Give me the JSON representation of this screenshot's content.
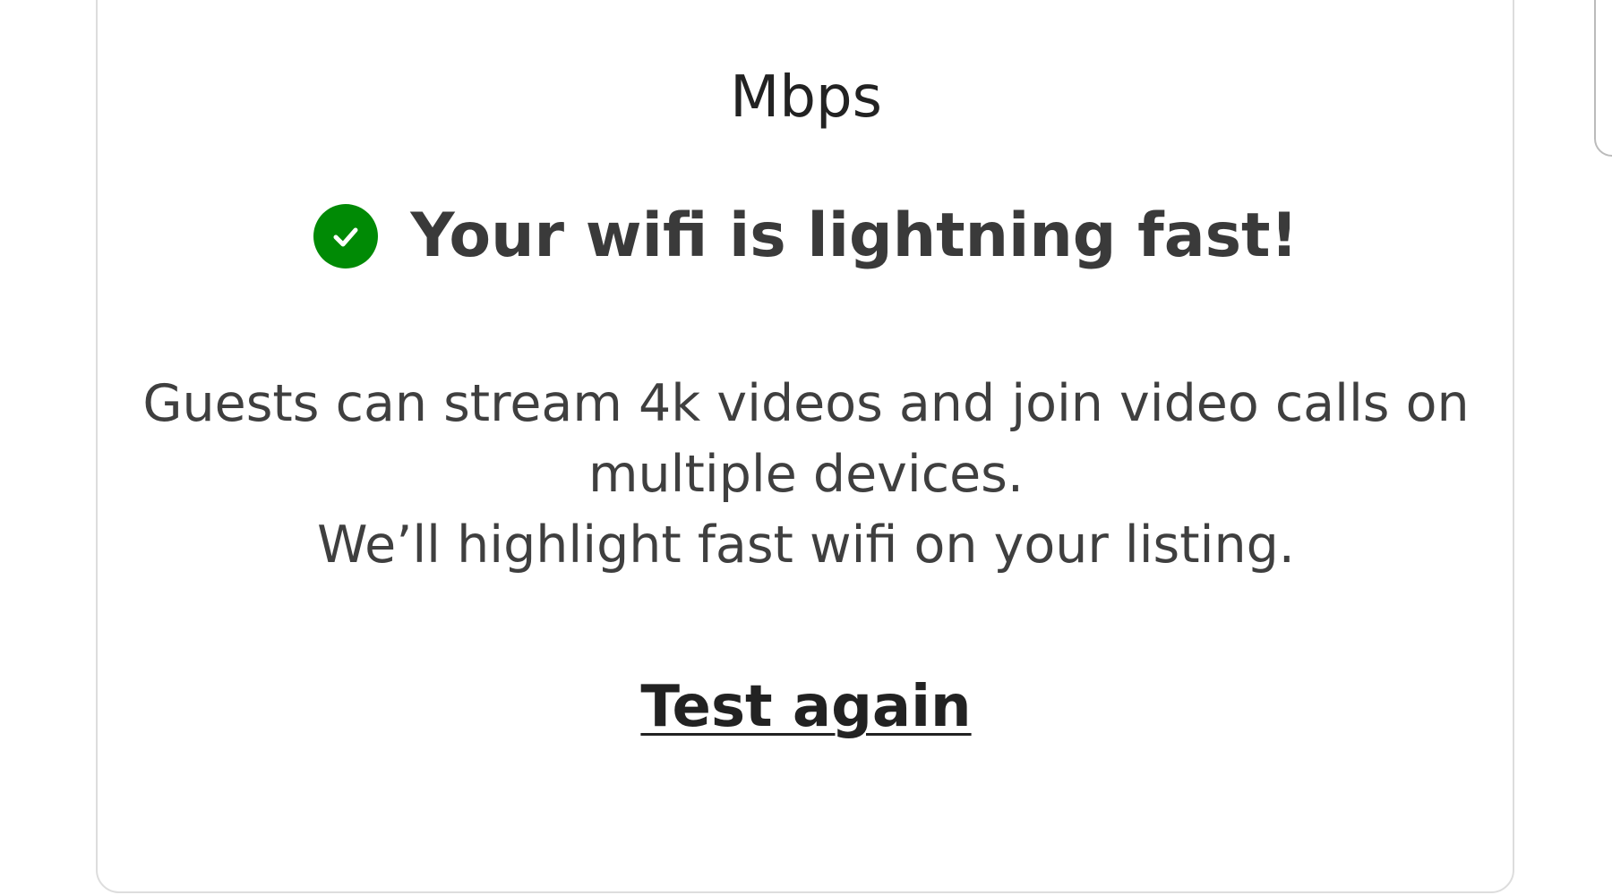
{
  "speed_card": {
    "unit_label": "Mbps",
    "status_icon": "check-circle-icon",
    "status_color": "#008a05",
    "status_text": "Your wifi is lightning fast!",
    "description_line1": "Guests can stream 4k videos and join video calls on multiple devices.",
    "description_line2": "We’ll highlight fast wifi on your listing.",
    "test_again_label": "Test again"
  }
}
